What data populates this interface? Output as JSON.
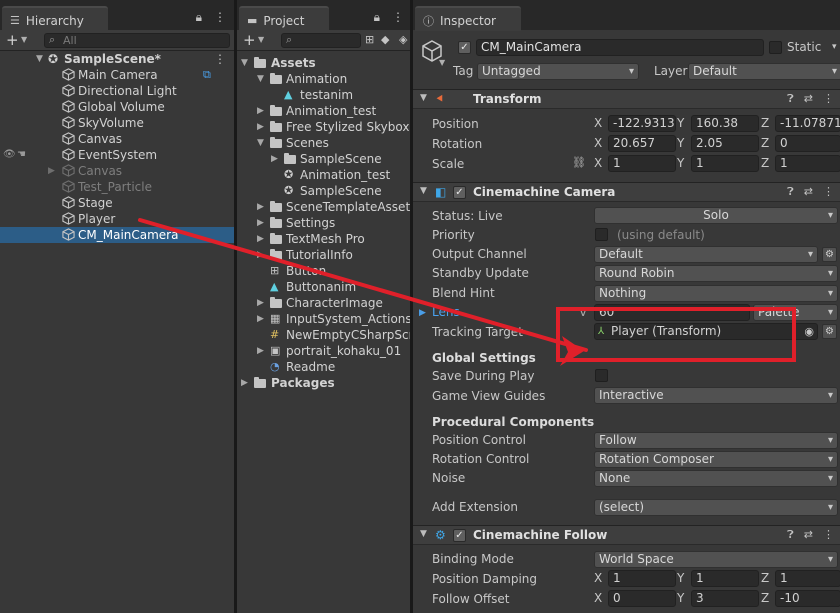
{
  "hierarchy": {
    "tab": "Hierarchy",
    "search_placeholder": "All",
    "scene": "SampleScene*",
    "items": [
      {
        "label": "Main Camera",
        "dim": false
      },
      {
        "label": "Directional Light",
        "dim": false
      },
      {
        "label": "Global Volume",
        "dim": false
      },
      {
        "label": "SkyVolume",
        "dim": false
      },
      {
        "label": "Canvas",
        "dim": false
      },
      {
        "label": "EventSystem",
        "dim": false
      },
      {
        "label": "Canvas",
        "dim": true
      },
      {
        "label": "Test_Particle",
        "dim": true
      },
      {
        "label": "Stage",
        "dim": false
      },
      {
        "label": "Player",
        "dim": false
      },
      {
        "label": "CM_MainCamera",
        "dim": false,
        "selected": true
      }
    ]
  },
  "project": {
    "tab": "Project",
    "root": "Assets",
    "items": [
      {
        "label": "Animation",
        "type": "folder",
        "open": true
      },
      {
        "label": "testanim",
        "type": "anim"
      },
      {
        "label": "Animation_test",
        "type": "folder"
      },
      {
        "label": "Free Stylized Skybox",
        "type": "folder"
      },
      {
        "label": "Scenes",
        "type": "folder",
        "open": true
      },
      {
        "label": "SampleScene",
        "type": "folder"
      },
      {
        "label": "Animation_test",
        "type": "scene"
      },
      {
        "label": "SampleScene",
        "type": "scene"
      },
      {
        "label": "SceneTemplateAssets",
        "type": "folder"
      },
      {
        "label": "Settings",
        "type": "folder"
      },
      {
        "label": "TextMesh Pro",
        "type": "folder"
      },
      {
        "label": "TutorialInfo",
        "type": "folder"
      },
      {
        "label": "Button",
        "type": "controller"
      },
      {
        "label": "Buttonanim",
        "type": "anim"
      },
      {
        "label": "CharacterImage",
        "type": "folder"
      },
      {
        "label": "InputSystem_Actions",
        "type": "input"
      },
      {
        "label": "NewEmptyCSharpScri",
        "type": "script"
      },
      {
        "label": "portrait_kohaku_01",
        "type": "image"
      },
      {
        "label": "Readme",
        "type": "readme"
      }
    ],
    "packages": "Packages"
  },
  "inspector": {
    "tab": "Inspector",
    "object_name": "CM_MainCamera",
    "static_label": "Static",
    "tag_label": "Tag",
    "tag_value": "Untagged",
    "layer_label": "Layer",
    "layer_value": "Default",
    "transform": {
      "title": "Transform",
      "position_label": "Position",
      "rotation_label": "Rotation",
      "scale_label": "Scale",
      "position": [
        "-122.9313",
        "160.38",
        "-11.07871"
      ],
      "rotation": [
        "20.657",
        "2.05",
        "0"
      ],
      "scale": [
        "1",
        "1",
        "1"
      ]
    },
    "cinemachine_camera": {
      "title": "Cinemachine Camera",
      "status_label": "Status: Live",
      "solo_label": "Solo",
      "priority_label": "Priority",
      "priority_hint": "(using default)",
      "output_channel_label": "Output Channel",
      "output_channel_value": "Default",
      "standby_update_label": "Standby Update",
      "standby_update_value": "Round Robin",
      "blend_hint_label": "Blend Hint",
      "blend_hint_value": "Nothing",
      "lens_label": "Lens",
      "lens_value": "60",
      "lens_preset": "Palette",
      "tracking_target_label": "Tracking Target",
      "tracking_target_value": "Player (Transform)",
      "global_settings_label": "Global Settings",
      "save_during_play_label": "Save During Play",
      "game_view_guides_label": "Game View Guides",
      "game_view_guides_value": "Interactive",
      "procedural_label": "Procedural Components",
      "position_control_label": "Position Control",
      "position_control_value": "Follow",
      "rotation_control_label": "Rotation Control",
      "rotation_control_value": "Rotation Composer",
      "noise_label": "Noise",
      "noise_value": "None",
      "add_extension_label": "Add Extension",
      "add_extension_value": "(select)"
    },
    "cinemachine_follow": {
      "title": "Cinemachine Follow",
      "binding_mode_label": "Binding Mode",
      "binding_mode_value": "World Space",
      "position_damping_label": "Position Damping",
      "position_damping": [
        "1",
        "1",
        "1"
      ],
      "follow_offset_label": "Follow Offset",
      "follow_offset": [
        "0",
        "3",
        "-10"
      ]
    }
  },
  "colors": {
    "annotation": "#e0202a",
    "selection": "#2c5d87",
    "panel": "#383838"
  }
}
